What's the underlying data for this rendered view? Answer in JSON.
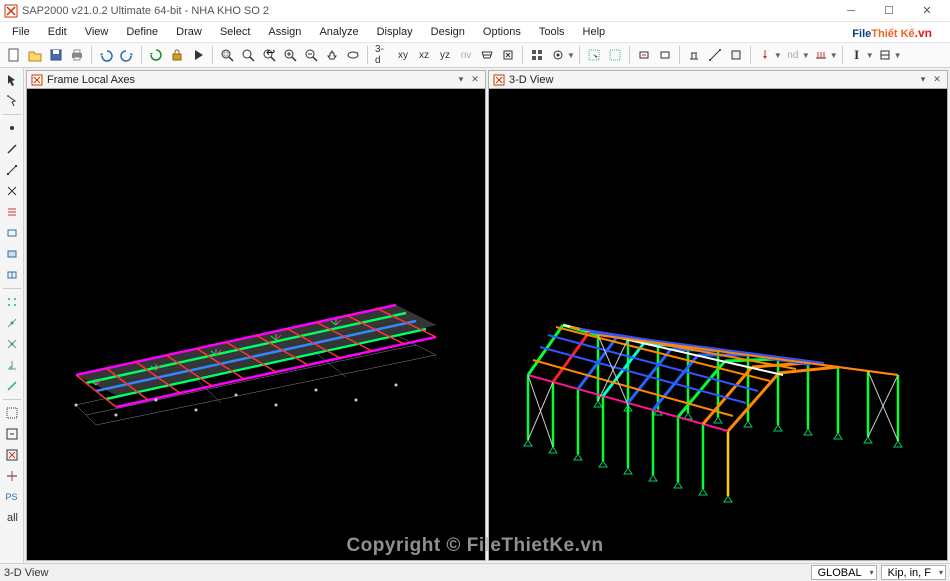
{
  "title": "SAP2000 v21.0.2 Ultimate 64-bit - NHA KHO SO 2",
  "menu": {
    "file": "File",
    "edit": "Edit",
    "view": "View",
    "define": "Define",
    "draw": "Draw",
    "select": "Select",
    "assign": "Assign",
    "analyze": "Analyze",
    "display": "Display",
    "design": "Design",
    "options": "Options",
    "tools": "Tools",
    "help": "Help"
  },
  "toolbar": {
    "view3d": "3-d",
    "viewxy": "xy",
    "viewxz": "xz",
    "viewyz": "yz",
    "viewnv": "nv",
    "ibeam": "I",
    "nd": "nd"
  },
  "views": {
    "left": {
      "title": "Frame Local Axes"
    },
    "right": {
      "title": "3-D View"
    }
  },
  "status": {
    "left_text": "3-D View",
    "coord_system": "GLOBAL",
    "units": "Kip, in, F"
  },
  "watermark": {
    "logo_part1": "File",
    "logo_part2": "Thiết Kế",
    "logo_part3": ".vn",
    "center": "Copyright © FileThietKe.vn"
  },
  "lefttools": {
    "ps": "PS"
  }
}
